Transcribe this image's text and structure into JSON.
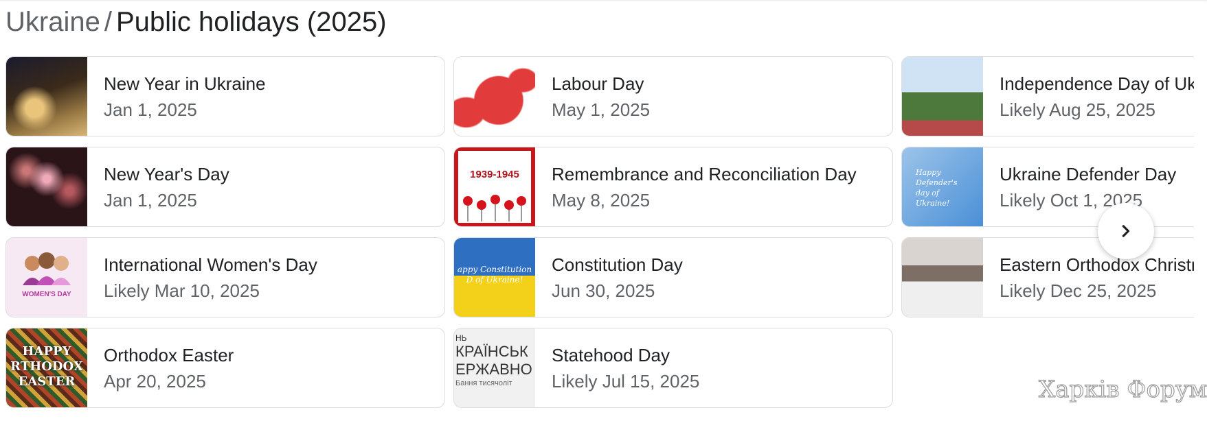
{
  "header": {
    "breadcrumb": "Ukraine",
    "separator": "/",
    "title": "Public holidays (2025)"
  },
  "holidays": [
    {
      "name": "New Year in Ukraine",
      "date": "Jan 1, 2025",
      "thumb": "new-year-village-image"
    },
    {
      "name": "New Year's Day",
      "date": "Jan 1, 2025",
      "thumb": "fireworks-image"
    },
    {
      "name": "International Women's Day",
      "date": "Likely Mar 10, 2025",
      "thumb": "womens-day-image",
      "thumb_text": "WOMEN'S DAY"
    },
    {
      "name": "Orthodox Easter",
      "date": "Apr 20, 2025",
      "thumb": "easter-eggs-image",
      "thumb_text": [
        "HAPPY",
        "RTHODOX",
        "EASTER"
      ]
    },
    {
      "name": "Labour Day",
      "date": "May 1, 2025",
      "thumb": "world-map-image"
    },
    {
      "name": "Remembrance and Reconciliation Day",
      "date": "May 8, 2025",
      "thumb": "poppies-image",
      "thumb_text": "1939-1945"
    },
    {
      "name": "Constitution Day",
      "date": "Jun 30, 2025",
      "thumb": "ukraine-flag-image",
      "thumb_text": "appy Constitution D of Ukraine!"
    },
    {
      "name": "Statehood Day",
      "date": "Likely Jul 15, 2025",
      "thumb": "statehood-text-image",
      "thumb_text": [
        "НЬ",
        "КРАЇНСЬК",
        "ЕРЖАВНО",
        "Бання тисячоліт"
      ]
    },
    {
      "name": "Independence Day of Ukraine",
      "date": "Likely Aug 25, 2025",
      "thumb": "independence-parade-image"
    },
    {
      "name": "Ukraine Defender Day",
      "date": "Likely Oct 1, 2025",
      "thumb": "defender-day-image",
      "thumb_text": "Happy Defender's day of Ukraine!"
    },
    {
      "name": "Eastern Orthodox Christmas",
      "date": "Likely Dec 25, 2025",
      "thumb": "christmas-crowd-image"
    }
  ],
  "next_button": {
    "icon": "chevron-right-icon"
  },
  "watermark": "Харків Форум"
}
